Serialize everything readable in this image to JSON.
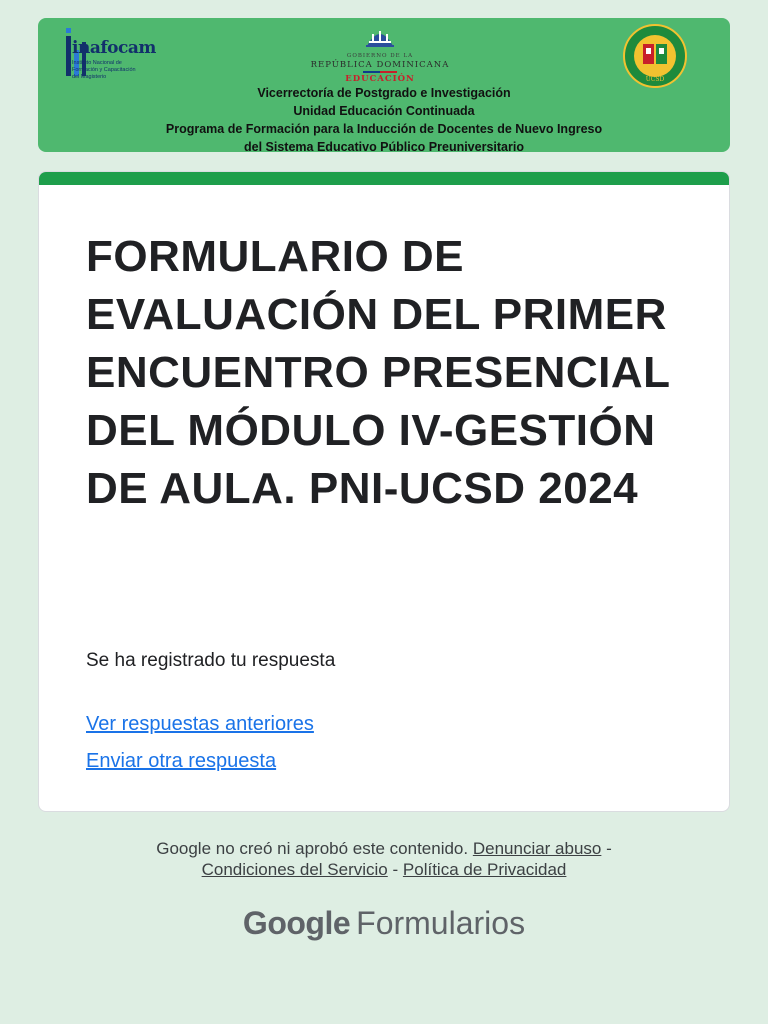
{
  "banner": {
    "inafocam": {
      "name": "inafocam",
      "subtitle": "Instituto Nacional de Formación y Capacitación del Magisterio"
    },
    "gov": {
      "small": "GOBIERNO DE LA",
      "country": "REPÚBLICA DOMINICANA",
      "ministry": "EDUCACIÓN"
    },
    "lines": [
      "Vicerrectoría de Postgrado e Investigación",
      "Unidad Educación Continuada",
      "Programa de Formación para la Inducción de Docentes de Nuevo Ingreso",
      "del Sistema Educativo Público Preuniversitario"
    ],
    "seal": {
      "text": "Universidad Católica Santo Domingo",
      "abbr": "UCSD"
    }
  },
  "form": {
    "title": "FORMULARIO DE EVALUACIÓN DEL PRIMER ENCUENTRO PRESENCIAL DEL MÓDULO IV-GESTIÓN DE AULA. PNI-UCSD 2024",
    "confirmation": "Se ha registrado tu respuesta",
    "view_previous": "Ver respuestas anteriores",
    "send_another": "Enviar otra respuesta"
  },
  "footer": {
    "disclaimer": "Google no creó ni aprobó este contenido.",
    "report_abuse": "Denunciar abuso",
    "separator": "-",
    "terms": "Condiciones del Servicio",
    "privacy": "Política de Privacidad",
    "brand_google": "Google",
    "brand_product": "Formularios"
  },
  "colors": {
    "banner_bg": "#4fb86f",
    "accent_bar": "#1e9e4b",
    "link": "#1a73e8",
    "page_bg": "#deeee3"
  }
}
